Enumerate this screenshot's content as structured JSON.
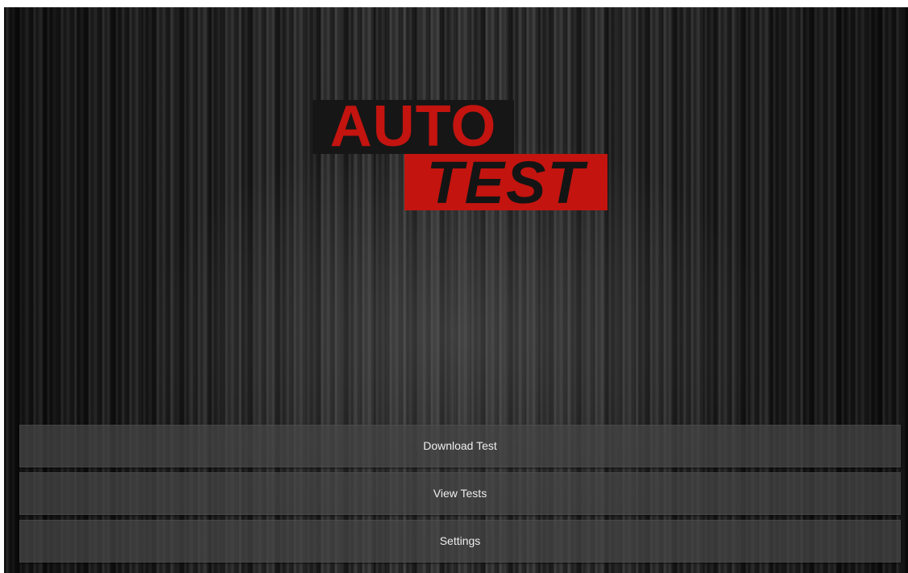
{
  "logo": {
    "line1": "AUTO",
    "line2": "TEST",
    "colors": {
      "red": "#c3140f",
      "dark": "#161616"
    }
  },
  "menu": {
    "items": [
      {
        "label": "Download Test"
      },
      {
        "label": "View Tests"
      },
      {
        "label": "Settings"
      }
    ]
  }
}
